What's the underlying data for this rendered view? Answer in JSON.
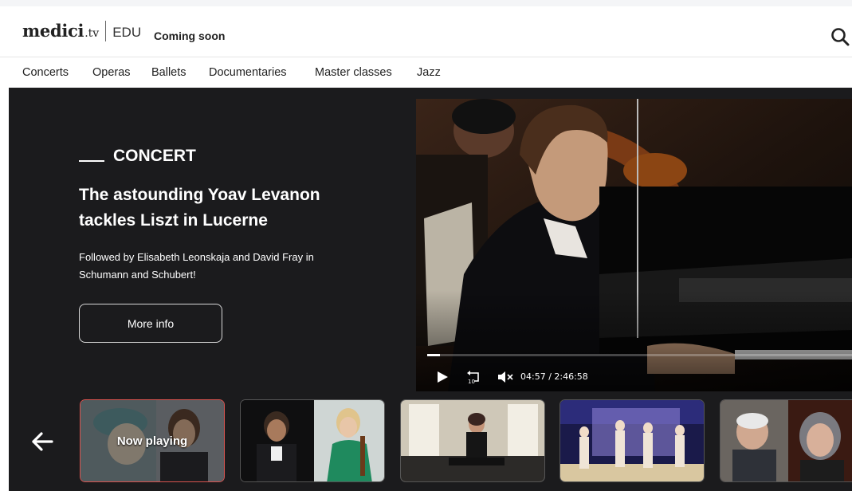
{
  "header": {
    "logo_main": "medici",
    "logo_tv": ".tv",
    "logo_edu": "EDU",
    "coming_soon": "Coming soon",
    "search_icon": "search-icon"
  },
  "nav": {
    "items": [
      "Concerts",
      "Operas",
      "Ballets",
      "Documentaries",
      "Master classes",
      "Jazz"
    ]
  },
  "hero": {
    "category": "CONCERT",
    "title_line1": "The astounding Yoav Levanon",
    "title_line2": "tackles Liszt in Lucerne",
    "subtitle_line1": "Followed by Elisabeth Leonskaja and David Fray in",
    "subtitle_line2": "Schumann and Schubert!",
    "more_info": "More info"
  },
  "player": {
    "current_time": "04:57",
    "duration": "2:46:58",
    "timecode": "04:57  /  2:46:58",
    "progress_fraction": 0.03,
    "icons": [
      "play-icon",
      "replay-10-icon",
      "mute-icon"
    ]
  },
  "carousel": {
    "back_icon": "arrow-left-icon",
    "now_playing": "Now playing"
  },
  "colors": {
    "hero_bg": "#1b1b1d",
    "active_border": "#d9534f",
    "text_dark": "#222222"
  }
}
